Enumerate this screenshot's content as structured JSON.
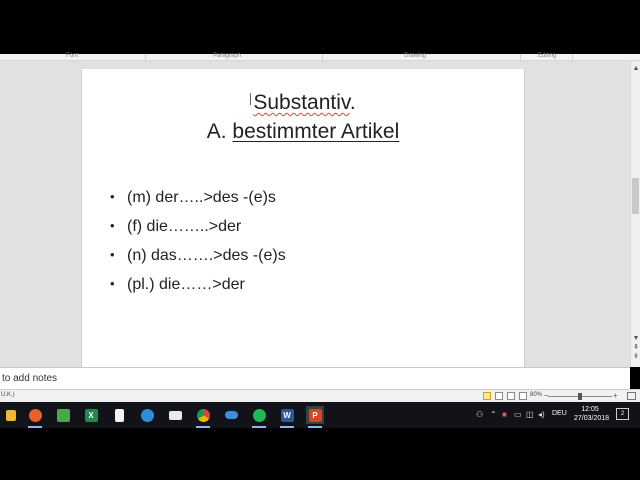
{
  "ribbon": {
    "groups": [
      "Font",
      "Paragraph",
      "Drawing",
      "Editing"
    ]
  },
  "slide": {
    "title_line1": "Substantiv",
    "title_line1_period": ".",
    "title_line2_prefix": "A. ",
    "title_line2_underlined": "bestimmter Artikel",
    "bullets": [
      "(m) der…..>des -(e)s",
      "(f) die……..>der",
      "(n) das…….>des -(e)s",
      "(pl.) die……>der"
    ],
    "bullet_glyph": "•"
  },
  "notes": {
    "placeholder": "to add notes"
  },
  "status_bar": {
    "language": "U.K.)",
    "zoom": "80%"
  },
  "taskbar": {
    "apps": [
      "store-icon",
      "firefox-icon",
      "photos-icon",
      "excel-like-icon",
      "file-icon",
      "edge-icon",
      "mail-icon",
      "chrome-icon",
      "onedrive-icon",
      "spotify-icon",
      "word-icon",
      "powerpoint-icon"
    ],
    "word_letter": "W",
    "powerpoint_letter": "P",
    "excel_letter": "X",
    "tray_language": "DEU",
    "time": "12:05",
    "date": "27/03/2018",
    "notification_count": "2"
  },
  "colors": {
    "taskbar": "#111318",
    "workspace": "#e1e1e1",
    "spell_error": "#e0443a",
    "powerpoint": "#d24726",
    "word": "#2b579a"
  }
}
